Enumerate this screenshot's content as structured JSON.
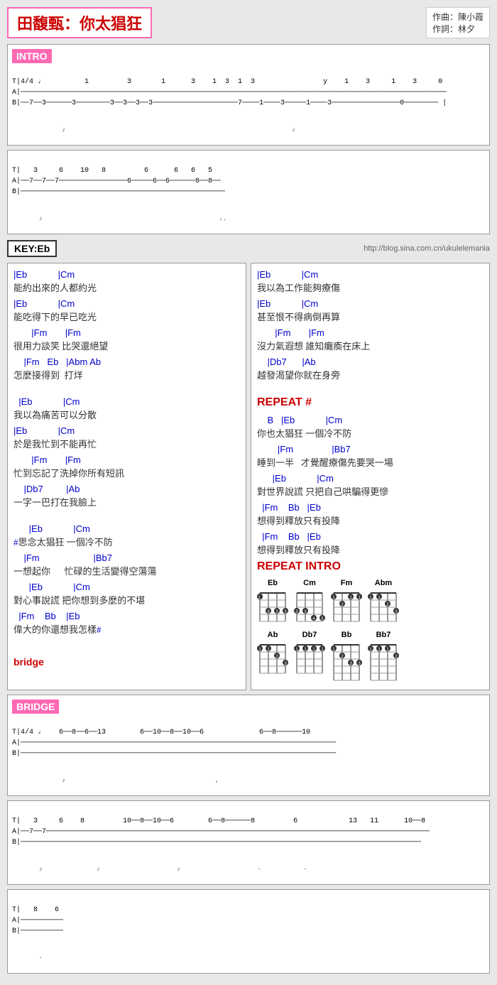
{
  "title": {
    "song": "田馥甄：你太猖狂",
    "composer_label": "作曲：陳小霞",
    "lyricist_label": "作詞：林夕"
  },
  "key": "KEY:Eb",
  "website": "http://blog.sina.com.cn/ukulelemania",
  "intro_label": "INTRO",
  "bridge_label": "BRIDGE",
  "left_col": {
    "verse1": [
      {
        "chord": "|Eb              |Cm",
        "lyric": "能約出來的人都約光"
      },
      {
        "chord": "|Eb              |Cm",
        "lyric": "能吃得下的早已吃光"
      },
      {
        "chord": "        |Fm          |Fm",
        "lyric": "很用力談笑 比哭還絕望"
      },
      {
        "chord": "    |Fm    Eb   |Abm  Ab",
        "lyric": "怎麼接得到  打烊"
      }
    ],
    "verse2": [
      {
        "chord": "   |Eb              |Cm",
        "lyric": "我以為痛苦可以分散"
      },
      {
        "chord": "|Eb              |Cm",
        "lyric": "於是我忙到不能再忙"
      },
      {
        "chord": "        |Fm          |Fm",
        "lyric": "忙到忘記了洗掉你所有短訊"
      },
      {
        "chord": "    |Db7             |Ab",
        "lyric": "一字一巴打在我臉上"
      }
    ],
    "verse3": [
      {
        "chord": "       |Eb              |Cm",
        "lyric": "#思念太猖狂 一個冷不防"
      },
      {
        "chord": "    |Fm                        |Bb7",
        "lyric": "一想起你      忙碌的生活變得空蕩蕩"
      },
      {
        "chord": "       |Eb              |Cm",
        "lyric": "對心事說謊 把你想到多麼的不堪"
      },
      {
        "chord": "  |Fm    Bb    |Eb",
        "lyric": "偉大的你還想我怎樣#"
      }
    ],
    "bridge_label": "bridge"
  },
  "right_col": {
    "verse1": [
      {
        "chord": "|Eb              |Cm",
        "lyric": "我以為工作能夠療傷"
      },
      {
        "chord": "|Eb              |Cm",
        "lyric": "甚至恨不得病倒再算"
      },
      {
        "chord": "        |Fm          |Fm",
        "lyric": "沒力氣遐想 誰知癱瘓在床上"
      },
      {
        "chord": "    |Db7       |Ab",
        "lyric": "越發渴望你就在身旁"
      }
    ],
    "repeat_label": "REPEAT #",
    "verse2": [
      {
        "chord": "    B   |Eb              |Cm",
        "lyric": "你也太猖狂 一個冷不防"
      },
      {
        "chord": "        |Fm                    |Bb7",
        "lyric": "睡到一半    才覺醒療傷先要哭一場"
      },
      {
        "chord": "       |Eb              |Cm",
        "lyric": "對世界說謊 只把自己哄騙得更慘"
      },
      {
        "chord": "  |Fm    Bb   |Eb",
        "lyric": "想得到釋放只有投降"
      },
      {
        "chord": "  |Fm    Bb   |Eb",
        "lyric": "想得到釋放只有投降"
      }
    ],
    "repeat_intro_label": "REPEAT INTRO",
    "chord_diagrams": {
      "row1": [
        {
          "name": "Eb",
          "positions": [
            [
              1,
              1
            ],
            [
              2,
              3
            ],
            [
              2,
              3
            ],
            [
              3,
              3
            ]
          ]
        },
        {
          "name": "Cm",
          "positions": [
            [
              1,
              3
            ],
            [
              1,
              3
            ],
            [
              2,
              4
            ],
            [
              3,
              5
            ]
          ]
        },
        {
          "name": "Fm",
          "positions": [
            [
              1,
              1
            ],
            [
              1,
              2
            ],
            [
              2,
              1
            ],
            [
              2,
              1
            ]
          ]
        },
        {
          "name": "Abm",
          "positions": [
            [
              1,
              1
            ],
            [
              2,
              1
            ],
            [
              3,
              2
            ],
            [
              3,
              3
            ]
          ]
        }
      ],
      "row2": [
        {
          "name": "Ab",
          "positions": [
            [
              1,
              1
            ],
            [
              1,
              1
            ],
            [
              2,
              2
            ],
            [
              3,
              3
            ]
          ]
        },
        {
          "name": "Db7",
          "positions": [
            [
              1,
              1
            ],
            [
              1,
              1
            ],
            [
              1,
              1
            ],
            [
              1,
              1
            ]
          ]
        },
        {
          "name": "Bb",
          "positions": [
            [
              1,
              1
            ],
            [
              1,
              2
            ],
            [
              2,
              3
            ],
            [
              3,
              3
            ]
          ]
        },
        {
          "name": "Bb7",
          "positions": [
            [
              1,
              1
            ],
            [
              1,
              1
            ],
            [
              1,
              1
            ],
            [
              2,
              2
            ]
          ]
        }
      ]
    }
  },
  "tab_intro": {
    "time_sig": "4/4",
    "line1": "  T  4/4     1         3       1      3    1  3  1  3                  y    1    3     1    3     0",
    "line2": "  A  ─────────────────────────────────────────────────────────────────────────────────────────────",
    "line3": "  B  ──7──3────────3────────3──3──3──3──────────────────────7─────1────3─────1────3──────────0────"
  },
  "tab_intro2": {
    "line1": "  T    3     6    10   8         6       6  6  5",
    "line2": "  A  ───7──7───7──────────────6────6──6────8──8──",
    "line3": "  B  ─────────────────────────────────────────────"
  },
  "tab_bridge": {
    "time_sig": "4/4",
    "line1": "6──8──6──13     6──10──8──10──6           6──8────10",
    "line2": "─────────────────────────────────────────────────────",
    "line3": "─────────────────────────────────────────────────────"
  }
}
